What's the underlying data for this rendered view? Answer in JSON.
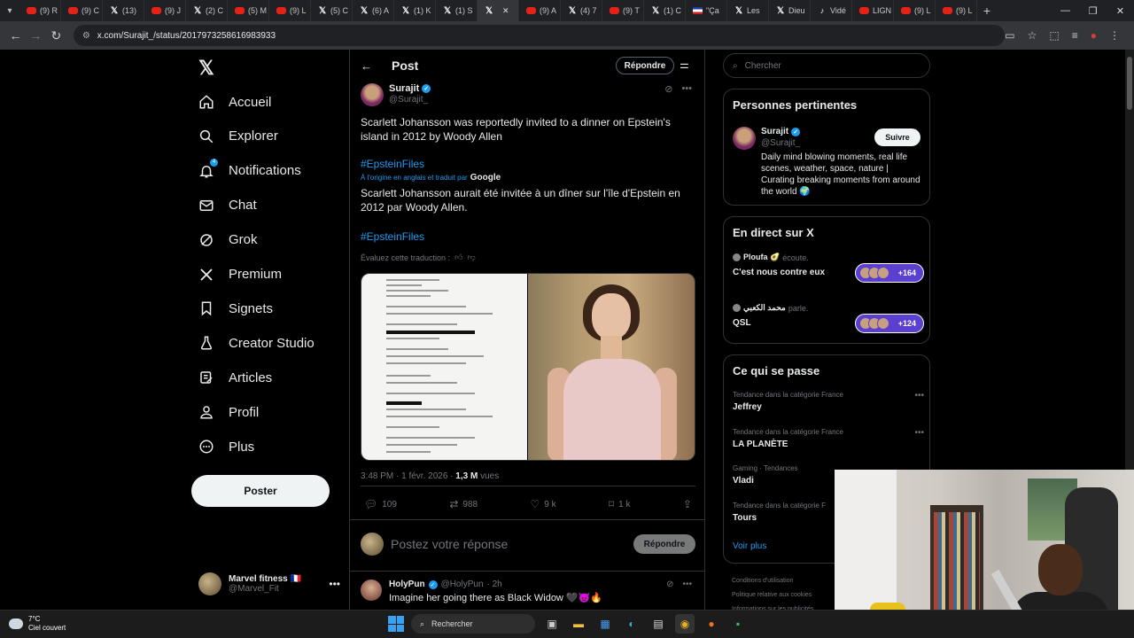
{
  "browser": {
    "tabs": [
      {
        "icon": "youtube-icon",
        "label": "(9) R"
      },
      {
        "icon": "youtube-icon",
        "label": "(9) C"
      },
      {
        "icon": "x-icon",
        "label": "(13)"
      },
      {
        "icon": "youtube-icon",
        "label": "(9) J"
      },
      {
        "icon": "x-icon",
        "label": "(2) C"
      },
      {
        "icon": "youtube-icon",
        "label": "(5) M"
      },
      {
        "icon": "youtube-icon",
        "label": "(9) L"
      },
      {
        "icon": "x-icon",
        "label": "(5) C"
      },
      {
        "icon": "x-icon",
        "label": "(6) A"
      },
      {
        "icon": "x-icon",
        "label": "(1) K"
      },
      {
        "icon": "x-icon",
        "label": "(1) S"
      },
      {
        "icon": "x-icon",
        "label": "",
        "active": true
      },
      {
        "icon": "youtube-icon",
        "label": "(9) A"
      },
      {
        "icon": "x-icon",
        "label": "(4) 7"
      },
      {
        "icon": "youtube-icon",
        "label": "(9) T"
      },
      {
        "icon": "x-icon",
        "label": "(1) C"
      },
      {
        "icon": "flag-icon",
        "label": "\"Ça"
      },
      {
        "icon": "x-icon",
        "label": "Les"
      },
      {
        "icon": "x-icon",
        "label": "Dieu"
      },
      {
        "icon": "tiktok-icon",
        "label": "Vidé"
      },
      {
        "icon": "youtube-icon",
        "label": "LIGN"
      },
      {
        "icon": "youtube-icon",
        "label": "(9) L"
      },
      {
        "icon": "youtube-icon",
        "label": "(9) L"
      }
    ],
    "url": "x.com/Surajit_/status/2017973258616983933"
  },
  "nav": {
    "items": [
      {
        "label": "Accueil",
        "icon": "home-icon"
      },
      {
        "label": "Explorer",
        "icon": "search-icon"
      },
      {
        "label": "Notifications",
        "icon": "bell-icon"
      },
      {
        "label": "Chat",
        "icon": "mail-icon"
      },
      {
        "label": "Grok",
        "icon": "grok-icon"
      },
      {
        "label": "Premium",
        "icon": "x-icon"
      },
      {
        "label": "Signets",
        "icon": "bookmark-icon"
      },
      {
        "label": "Creator Studio",
        "icon": "creator-studio-icon"
      },
      {
        "label": "Articles",
        "icon": "articles-icon"
      },
      {
        "label": "Profil",
        "icon": "person-icon"
      },
      {
        "label": "Plus",
        "icon": "more-circle-icon"
      }
    ],
    "notif_badge": "4",
    "post_button": "Poster",
    "account": {
      "name": "Marvel fitness 🇫🇷",
      "handle": "@Marvel_Fit"
    }
  },
  "main": {
    "header_title": "Post",
    "reply_button": "Répondre",
    "tweet": {
      "author": "Surajit",
      "handle": "@Surajit_",
      "text": "Scarlett Johansson was reportedly invited to a dinner on Epstein's island in 2012 by Woody Allen",
      "hashtag": "#EpsteinFiles",
      "translated_label": "À l'origine en anglais et traduit par",
      "translated_by": "Google",
      "translated_text": "Scarlett Johansson aurait été invitée à un dîner sur l'île d'Epstein en 2012 par Woody Allen.",
      "rate_translation": "Évaluez cette traduction :",
      "time": "3:48 PM · 1 févr. 2026",
      "views_count": "1,3 M",
      "views_label": "vues",
      "replies": "109",
      "retweets": "988",
      "likes": "9 k",
      "bookmarks": "1 k"
    },
    "compose": {
      "placeholder": "Postez votre réponse",
      "button": "Répondre"
    },
    "reply": {
      "author": "HolyPun",
      "handle": "@HolyPun",
      "time": "· 2h",
      "text": "Imagine her going there as Black Widow 🖤😈🔥"
    }
  },
  "sidebar": {
    "search_placeholder": "Chercher",
    "people": {
      "title": "Personnes pertinentes",
      "name": "Surajit",
      "handle": "@Surajit_",
      "follow": "Suivre",
      "bio": "Daily mind blowing moments, real life scenes, weather, space, nature | Curating breaking moments from around the world 🌍"
    },
    "live": {
      "title": "En direct sur X",
      "items": [
        {
          "host": "Ploufa 🥑",
          "action": "écoute.",
          "title": "C'est nous contre eux",
          "count": "+164"
        },
        {
          "host": "محمد الكعبي",
          "action": "parle.",
          "title": "QSL",
          "count": "+124"
        }
      ]
    },
    "trends": {
      "title": "Ce qui se passe",
      "items": [
        {
          "category": "Tendance dans la catégorie France",
          "name": "Jeffrey"
        },
        {
          "category": "Tendance dans la catégorie France",
          "name": "LA PLANÈTE"
        },
        {
          "category": "Gaming · Tendances",
          "name": "Vladi"
        },
        {
          "category": "Tendance dans la catégorie F",
          "name": "Tours"
        }
      ],
      "see_more": "Voir plus"
    },
    "footer": [
      "Conditions d'utilisation",
      "Politique relative aux cookies",
      "Informations sur les publicités"
    ]
  },
  "taskbar": {
    "temperature": "7°C",
    "weather": "Ciel couvert",
    "search": "Rechercher"
  }
}
